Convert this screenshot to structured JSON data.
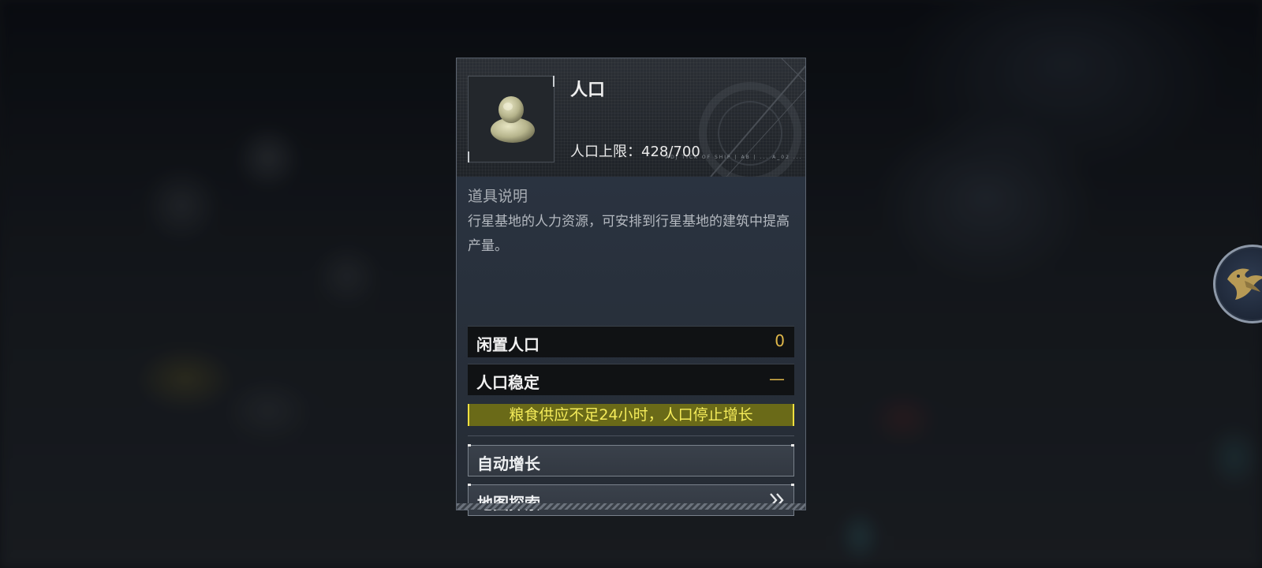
{
  "background": {
    "description_color": "#15181d"
  },
  "panel": {
    "title": "人口",
    "icon": "person-icon",
    "population_cap_label": "人口上限：428/700",
    "header_ticks": "ADJ TICK OF SHIP   |   AB   |  ...   A_02   ...",
    "description_title": "道具说明",
    "description_text": "行星基地的人力资源，可安排到行星基地的建筑中提高产量。",
    "stats": [
      {
        "label": "闲置人口",
        "value": "0"
      },
      {
        "label": "人口稳定",
        "value": "—"
      }
    ],
    "warning": "粮食供应不足24小时，人口停止增长",
    "actions": [
      {
        "label": "自动增长",
        "icon": ""
      },
      {
        "label": "地图探索",
        "icon": "double-chevron-right-icon"
      }
    ]
  },
  "side_button": {
    "icon": "phoenix-icon"
  },
  "colors": {
    "accent_gold": "#e0b84a",
    "warning_text": "#f5ec5a",
    "warning_bg": "#6a6a18"
  }
}
